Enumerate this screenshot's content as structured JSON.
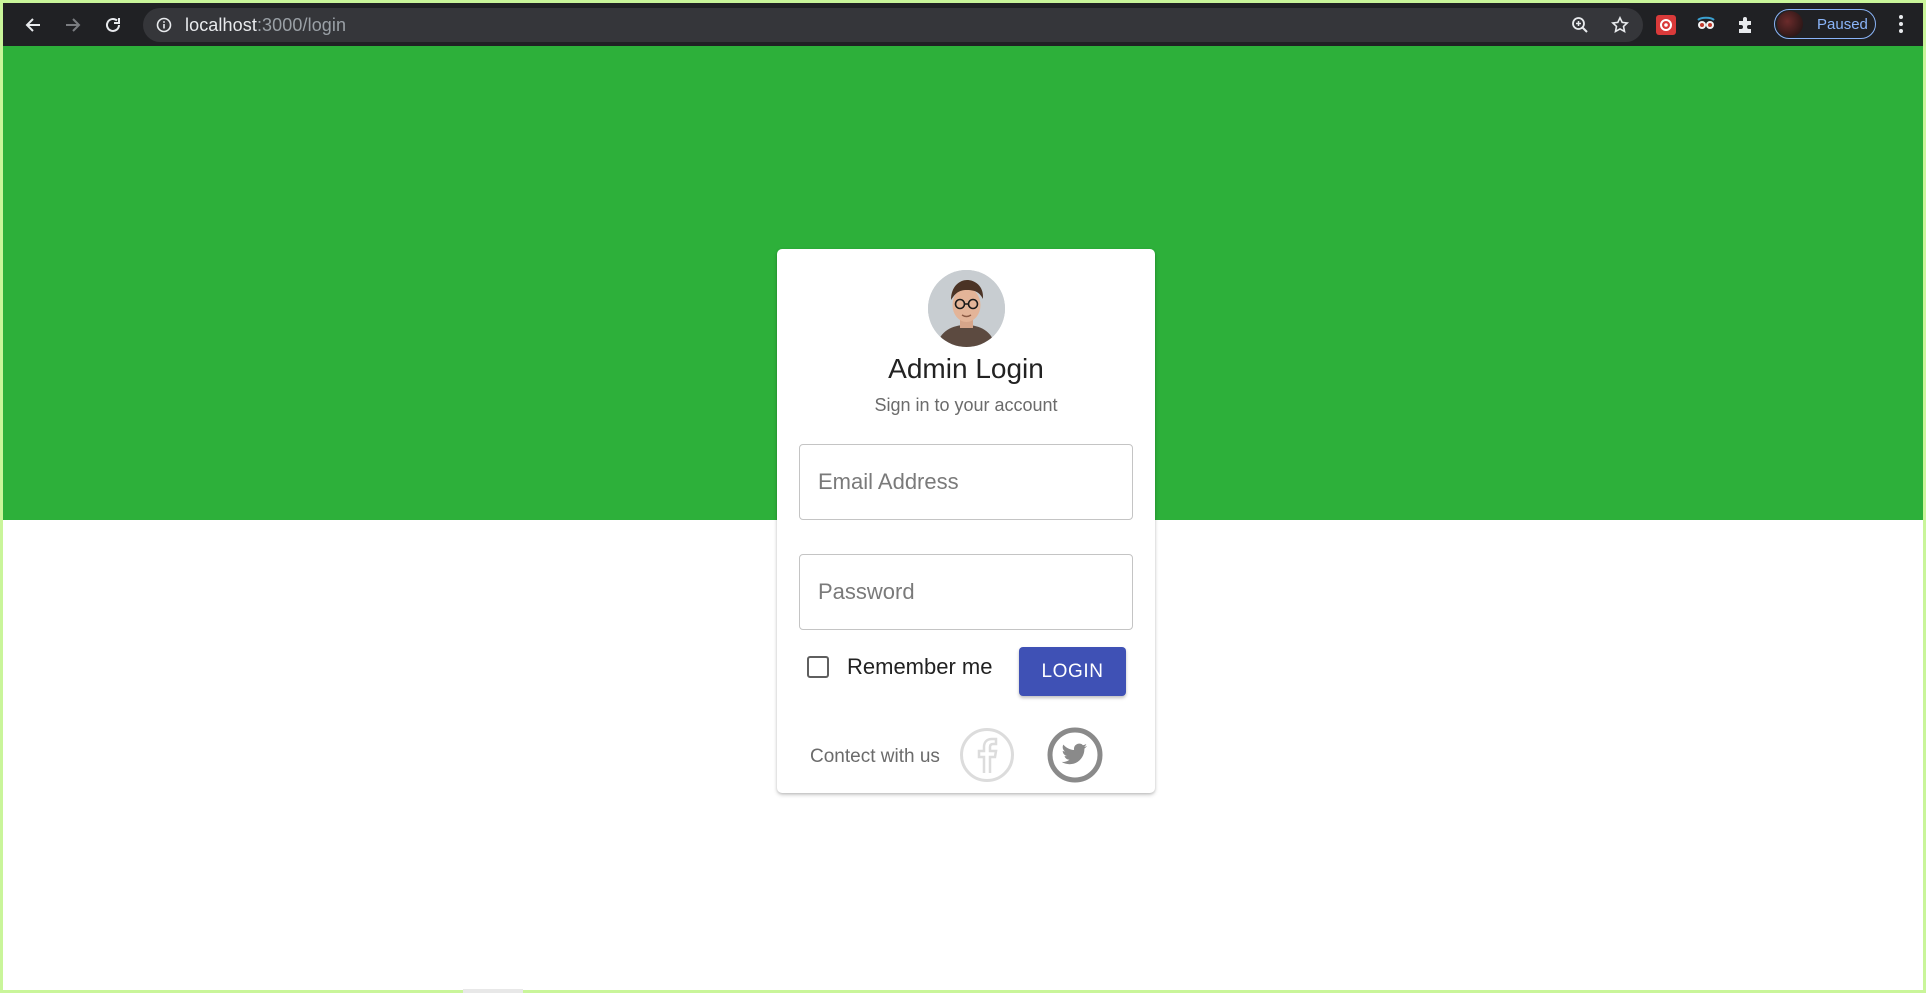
{
  "browser": {
    "url_host": "localhost",
    "url_path": ":3000/login",
    "profile_status": "Paused"
  },
  "page": {
    "hero_color": "#2db03a",
    "accent_color": "#3f51b5"
  },
  "login": {
    "title": "Admin Login",
    "subtitle": "Sign in to your account",
    "email_placeholder": "Email Address",
    "email_value": "",
    "password_placeholder": "Password",
    "password_value": "",
    "remember_label": "Remember me",
    "remember_checked": false,
    "login_button": "LOGIN",
    "contact_label": "Contect with us",
    "social": [
      "facebook-icon",
      "twitter-icon"
    ]
  }
}
